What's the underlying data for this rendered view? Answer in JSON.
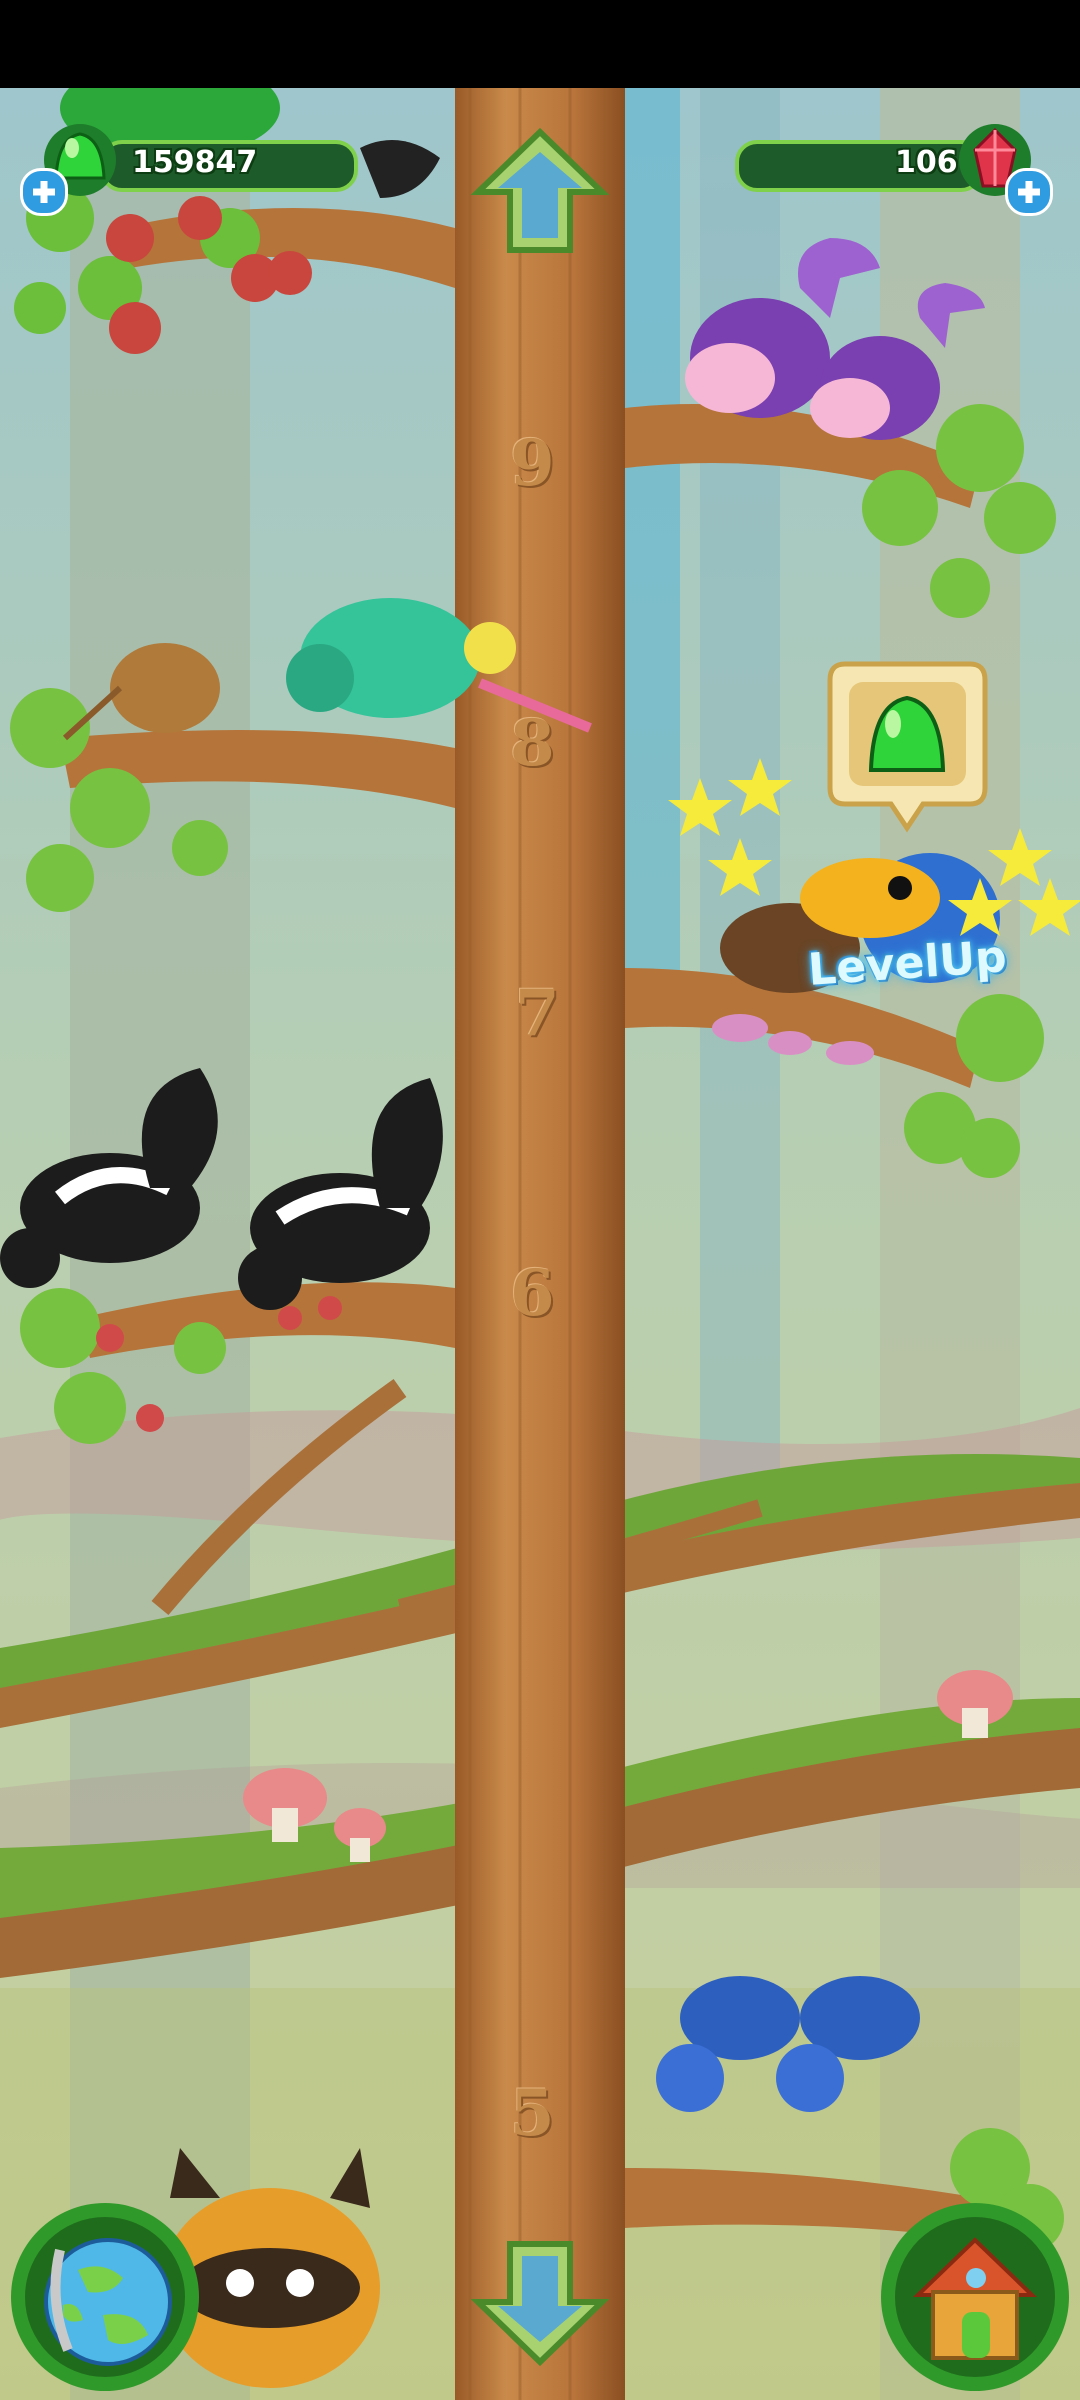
{
  "hud": {
    "gems_count": "159847",
    "rubies_count": "106"
  },
  "branch_numbers": [
    "9",
    "8",
    "7",
    "6",
    "5"
  ],
  "popup": {
    "levelup_text": "LevelUp"
  },
  "icons": {
    "gem": "green-gem-icon",
    "ruby": "red-crystal-icon",
    "add": "plus-icon",
    "up": "arrow-up-icon",
    "down": "arrow-down-icon",
    "globe": "globe-icon",
    "house": "house-icon"
  },
  "colors": {
    "hud_bar": "#1e5b2a",
    "gem_green": "#2fd33a",
    "trunk": "#c07a3e",
    "leaf": "#7cc444",
    "plus_blue": "#2f9be0"
  }
}
